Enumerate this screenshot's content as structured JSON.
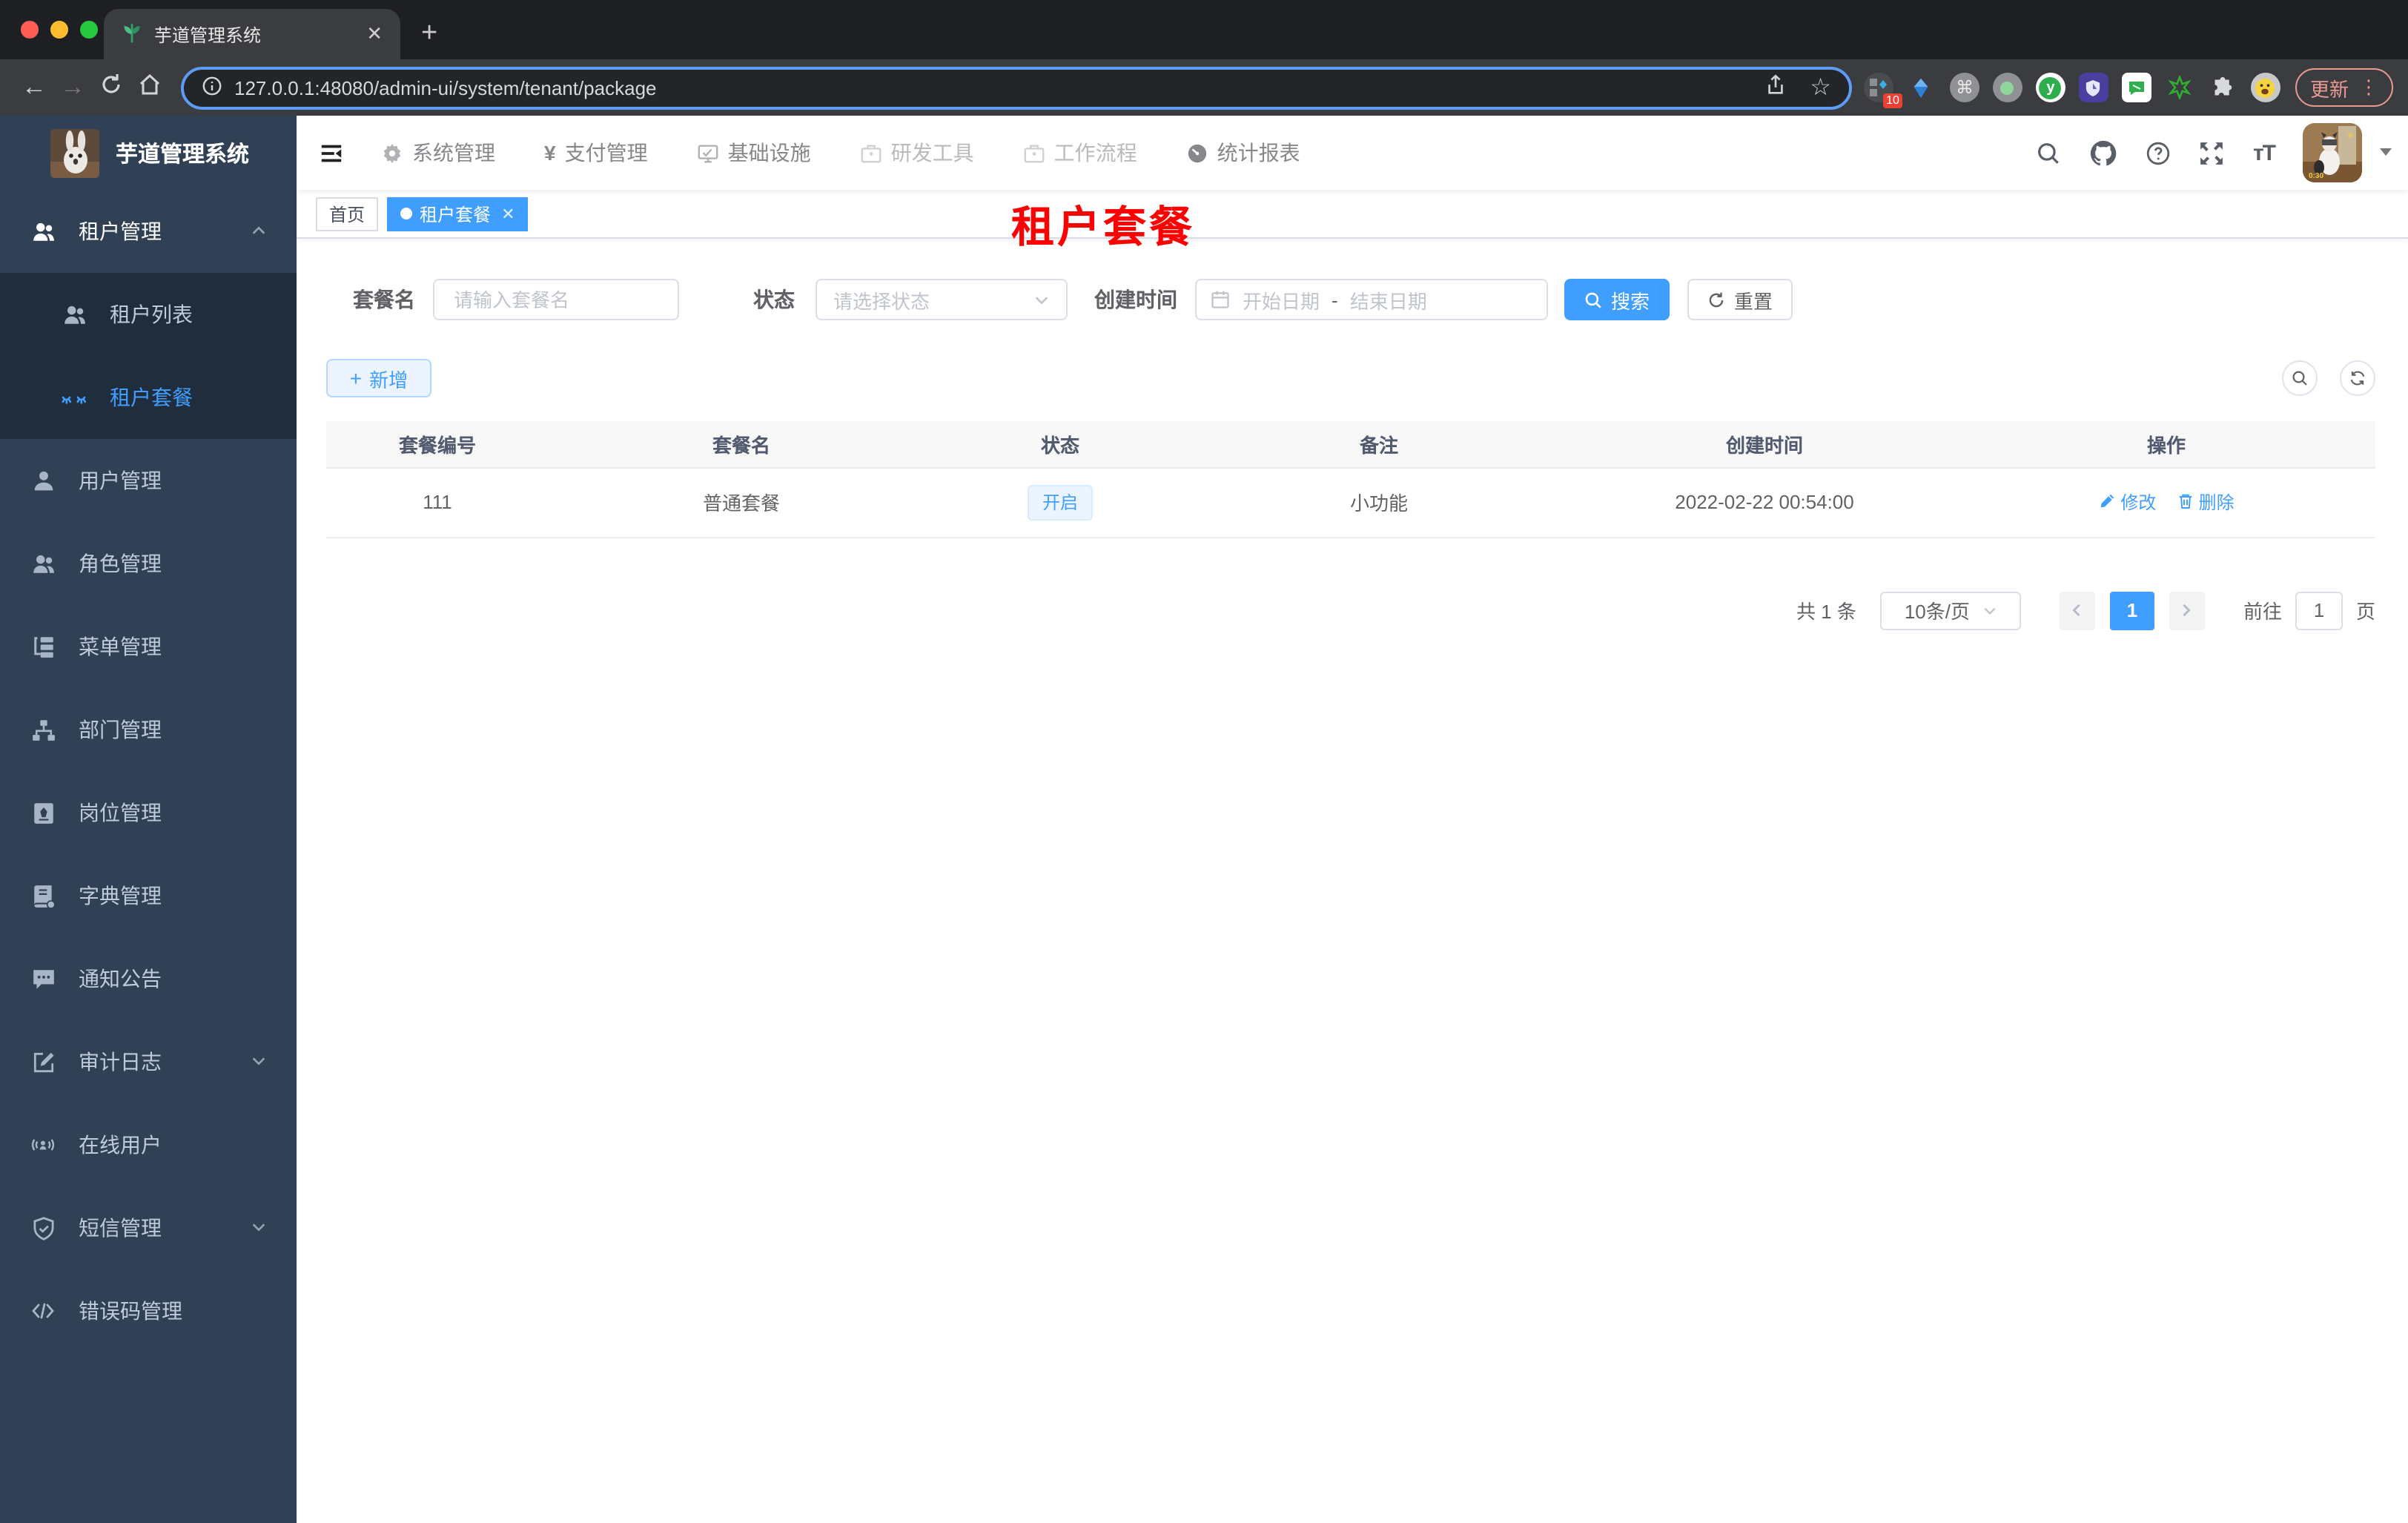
{
  "browser": {
    "tab_title": "芋道管理系统",
    "url": "127.0.0.1:48080/admin-ui/system/tenant/package",
    "ext_badge": "10",
    "update_label": "更新"
  },
  "sidebar": {
    "title": "芋道管理系统",
    "items": [
      {
        "label": "租户管理"
      },
      {
        "label": "租户列表"
      },
      {
        "label": "租户套餐"
      },
      {
        "label": "用户管理"
      },
      {
        "label": "角色管理"
      },
      {
        "label": "菜单管理"
      },
      {
        "label": "部门管理"
      },
      {
        "label": "岗位管理"
      },
      {
        "label": "字典管理"
      },
      {
        "label": "通知公告"
      },
      {
        "label": "审计日志"
      },
      {
        "label": "在线用户"
      },
      {
        "label": "短信管理"
      },
      {
        "label": "错误码管理"
      }
    ]
  },
  "topnav": {
    "items": [
      "系统管理",
      "支付管理",
      "基础设施",
      "研发工具",
      "工作流程",
      "统计报表"
    ]
  },
  "tags": {
    "home": "首页",
    "active": "租户套餐"
  },
  "annotation": {
    "text": "租户套餐",
    "color": "#fe0000"
  },
  "filters": {
    "name_label": "套餐名",
    "name_placeholder": "请输入套餐名",
    "status_label": "状态",
    "status_placeholder": "请选择状态",
    "time_label": "创建时间",
    "start_placeholder": "开始日期",
    "range_sep": "-",
    "end_placeholder": "结束日期",
    "search_label": "搜索",
    "reset_label": "重置"
  },
  "toolbar": {
    "add_label": "新增"
  },
  "table": {
    "headers": [
      "套餐编号",
      "套餐名",
      "状态",
      "备注",
      "创建时间",
      "操作"
    ],
    "row": {
      "id": "111",
      "name": "普通套餐",
      "status": "开启",
      "remark": "小功能",
      "created": "2022-02-22 00:54:00"
    },
    "actions": {
      "edit": "修改",
      "delete": "删除"
    }
  },
  "pagination": {
    "total": "共 1 条",
    "size": "10条/页",
    "current": "1",
    "goto_label": "前往",
    "goto_value": "1",
    "unit": "页"
  },
  "colors": {
    "accent": "#409eff",
    "sidebar_bg": "#304156",
    "submenu_bg": "#1f2d3d",
    "annotation_red": "#fe0000",
    "tag_active_bg": "#409eff",
    "status_tag_bg": "#ecf5ff"
  }
}
